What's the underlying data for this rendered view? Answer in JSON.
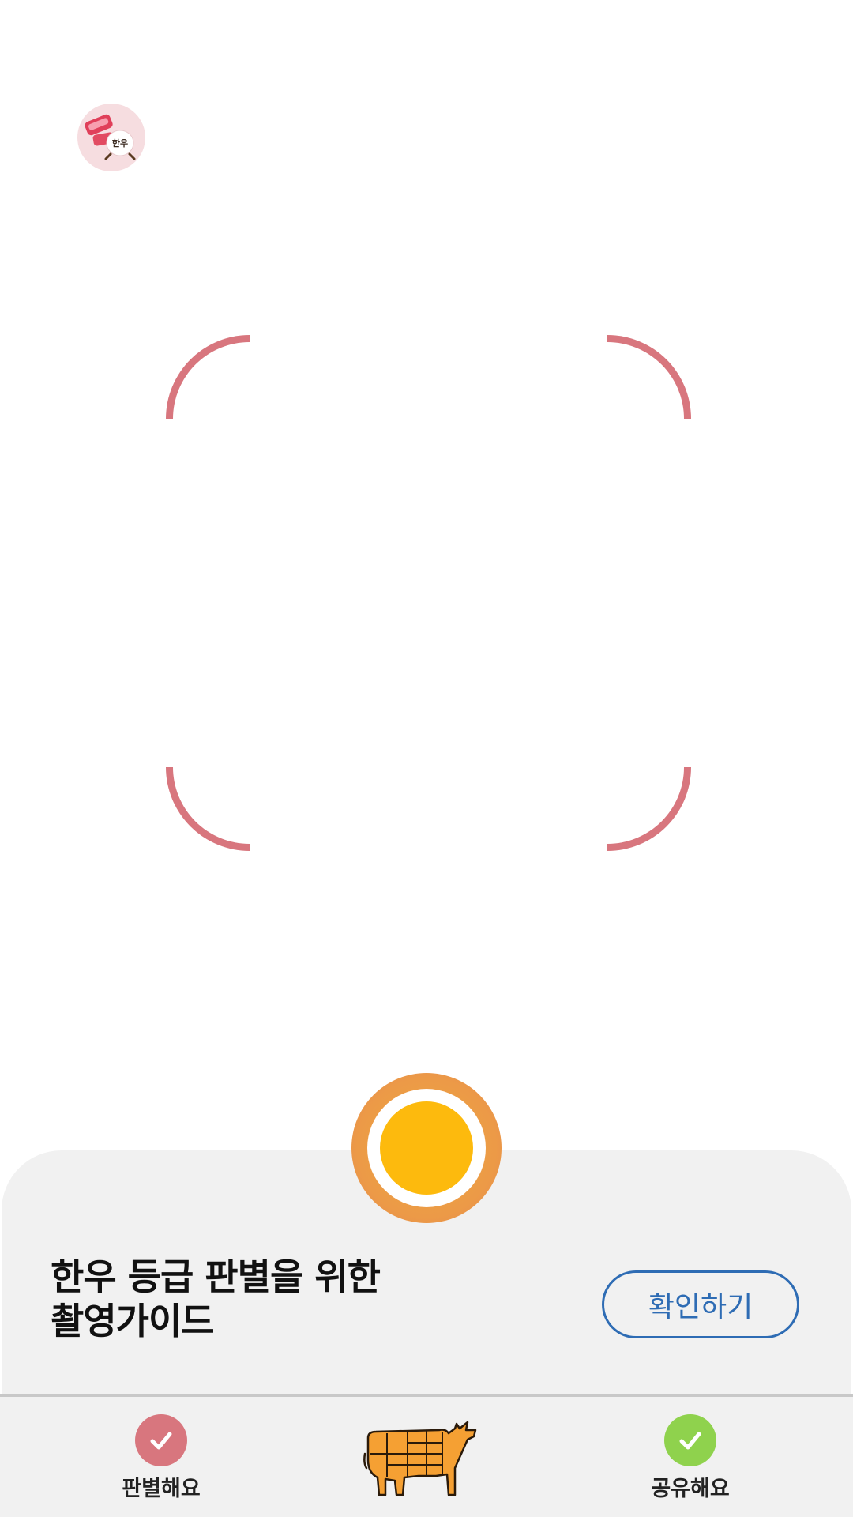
{
  "header": {
    "logo_icon": "hanwoo-logo-icon",
    "logo_text": "한우"
  },
  "camera_frame": {
    "color": "#d8767e"
  },
  "shutter": {
    "icon": "shutter-icon",
    "outer_color": "#ec9a47",
    "core_color": "#fdba0d"
  },
  "guide_panel": {
    "title_line1": "한우 등급 판별을 위한",
    "title_line2": "촬영가이드",
    "confirm_label": "확인하기",
    "accent_color": "#2e6cb4"
  },
  "bottom_nav": {
    "items": [
      {
        "label": "판별해요",
        "icon": "check-circle-icon",
        "color": "#d8767e"
      },
      {
        "label": "",
        "icon": "beef-cuts-cow-icon",
        "color": "#f5a033"
      },
      {
        "label": "공유해요",
        "icon": "check-circle-icon",
        "color": "#8fd24d"
      }
    ]
  }
}
